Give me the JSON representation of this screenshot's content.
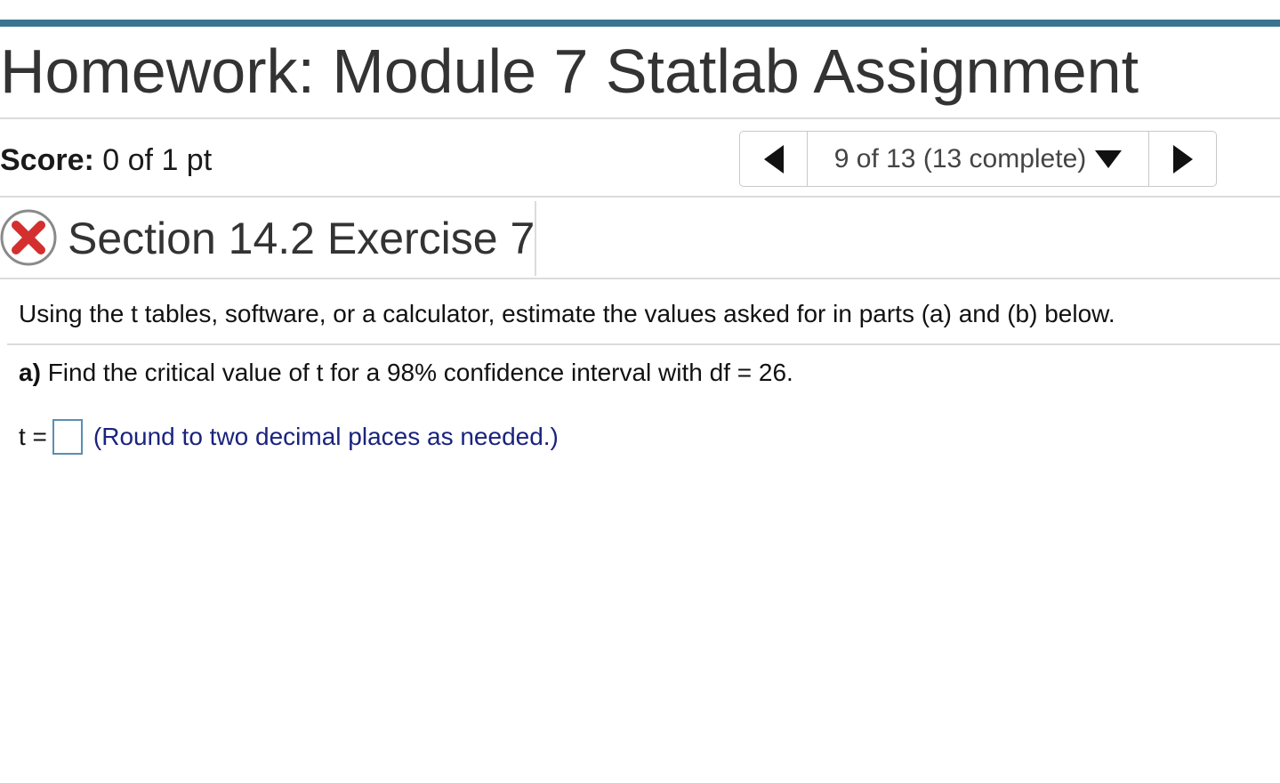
{
  "header": {
    "title": "Homework: Module 7 Statlab Assignment",
    "accent_color": "#3a7490"
  },
  "score": {
    "label": "Score:",
    "value": "0 of 1 pt"
  },
  "pager": {
    "status": "9 of 13 (13 complete)",
    "prev_icon": "triangle-left-icon",
    "next_icon": "triangle-right-icon",
    "dropdown_icon": "triangle-down-icon"
  },
  "section": {
    "status_icon": "incorrect-x-icon",
    "status_color": "#d32f2f",
    "title": "Section 14.2 Exercise 7"
  },
  "question": {
    "instructions": "Using the t tables, software, or a calculator, estimate the values asked for in parts (a) and (b) below.",
    "part_a_label": "a)",
    "part_a_text": "Find the critical value of t for a 98% confidence interval with df = 26.",
    "answer_prefix": "t =",
    "answer_value": "",
    "hint": "(Round to two decimal places as needed.)",
    "hint_color": "#1a237e"
  }
}
